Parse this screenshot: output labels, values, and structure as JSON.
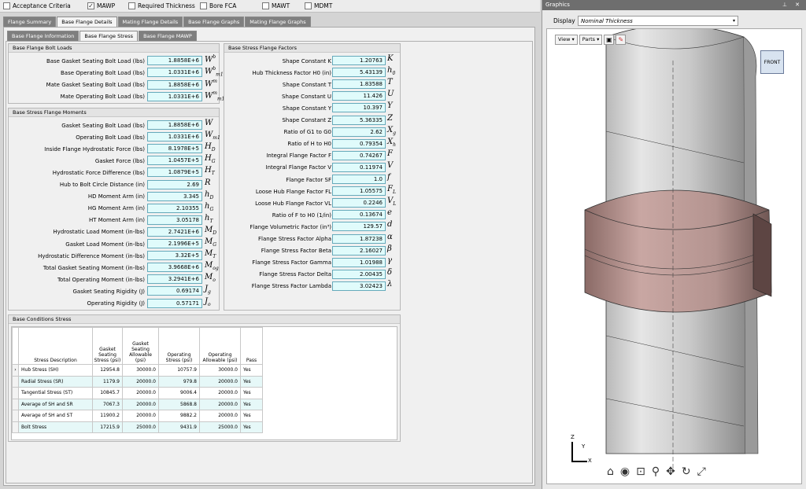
{
  "topbar": [
    {
      "label": "Acceptance Criteria",
      "checked": false
    },
    {
      "label": "MAWP",
      "checked": true
    },
    {
      "label": "Required Thickness",
      "checked": false
    },
    {
      "label": "Bore FCA",
      "checked": false
    },
    {
      "label": "MAWT",
      "checked": false
    },
    {
      "label": "MDMT",
      "checked": false
    }
  ],
  "tabs": [
    "Flange Summary",
    "Base Flange Details",
    "Mating Flange Details",
    "Base Flange Graphs",
    "Mating Flange Graphs"
  ],
  "subtabs": [
    "Base Flange Information",
    "Base Flange Stress",
    "Base Flange MAWP"
  ],
  "bolt_loads": {
    "title": "Base Flange Bolt Loads",
    "rows": [
      {
        "label": "Base Gasket Seating Bolt Load (lbs)",
        "value": "1.8858E+6",
        "sym": "W",
        "sup": "b",
        "sub": ""
      },
      {
        "label": "Base Operating Bolt Load (lbs)",
        "value": "1.0331E+6",
        "sym": "W",
        "sup": "b",
        "sub": "m1"
      },
      {
        "label": "Mate Gasket Seating Bolt Load (lbs)",
        "value": "1.8858E+6",
        "sym": "W",
        "sup": "m",
        "sub": ""
      },
      {
        "label": "Mate Operating Bolt Load (lbs)",
        "value": "1.0331E+6",
        "sym": "W",
        "sup": "m",
        "sub": "m1"
      }
    ]
  },
  "moments": {
    "title": "Base Stress Flange Moments",
    "rows": [
      {
        "label": "Gasket Seating Bolt Load (lbs)",
        "value": "1.8858E+6",
        "sym": "W",
        "sub": ""
      },
      {
        "label": "Operating Bolt Load (lbs)",
        "value": "1.0331E+6",
        "sym": "W",
        "sub": "m1"
      },
      {
        "label": "Inside Flange Hydrostatic Force (lbs)",
        "value": "8.1978E+5",
        "sym": "H",
        "sub": "D"
      },
      {
        "label": "Gasket Force (lbs)",
        "value": "1.0457E+5",
        "sym": "H",
        "sub": "G"
      },
      {
        "label": "Hydrostatic Force Difference (lbs)",
        "value": "1.0879E+5",
        "sym": "H",
        "sub": "T"
      },
      {
        "label": "Hub to Bolt Circle Distance (in)",
        "value": "2.69",
        "sym": "R",
        "sub": ""
      },
      {
        "label": "HD Moment Arm (in)",
        "value": "3.345",
        "sym": "h",
        "sub": "D"
      },
      {
        "label": "HG Moment Arm (in)",
        "value": "2.10355",
        "sym": "h",
        "sub": "G"
      },
      {
        "label": "HT Moment Arm (in)",
        "value": "3.05178",
        "sym": "h",
        "sub": "T"
      },
      {
        "label": "Hydrostatic Load Moment (in-lbs)",
        "value": "2.7421E+6",
        "sym": "M",
        "sub": "D"
      },
      {
        "label": "Gasket Load Moment (in-lbs)",
        "value": "2.1996E+5",
        "sym": "M",
        "sub": "G"
      },
      {
        "label": "Hydrostatic Difference Moment (in-lbs)",
        "value": "3.32E+5",
        "sym": "M",
        "sub": "T"
      },
      {
        "label": "Total Gasket Seating Moment (in-lbs)",
        "value": "3.9668E+6",
        "sym": "M",
        "sub": "og"
      },
      {
        "label": "Total Operating Moment (in-lbs)",
        "value": "3.2941E+6",
        "sym": "M",
        "sub": "o"
      },
      {
        "label": "Gasket Seating Rigidity (J)",
        "value": "0.69174",
        "sym": "J",
        "sub": "g"
      },
      {
        "label": "Operating Rigidity (J)",
        "value": "0.57171",
        "sym": "J",
        "sub": "o"
      }
    ]
  },
  "factors": {
    "title": "Base Stress Flange Factors",
    "rows": [
      {
        "label": "Shape Constant K",
        "value": "1.20763",
        "sym": "K",
        "sub": ""
      },
      {
        "label": "Hub Thickness Factor H0 (in)",
        "value": "5.43139",
        "sym": "h",
        "sub": "0"
      },
      {
        "label": "Shape Constant T",
        "value": "1.83588",
        "sym": "T",
        "sub": ""
      },
      {
        "label": "Shape Constant U",
        "value": "11.426",
        "sym": "U",
        "sub": ""
      },
      {
        "label": "Shape Constant Y",
        "value": "10.397",
        "sym": "Y",
        "sub": ""
      },
      {
        "label": "Shape Constant Z",
        "value": "5.36335",
        "sym": "Z",
        "sub": ""
      },
      {
        "label": "Ratio of G1 to G0",
        "value": "2.62",
        "sym": "X",
        "sub": "g"
      },
      {
        "label": "Ratio of H to H0",
        "value": "0.79354",
        "sym": "X",
        "sub": "h"
      },
      {
        "label": "Integral Flange Factor F",
        "value": "0.74267",
        "sym": "F",
        "sub": ""
      },
      {
        "label": "Integral Flange Factor V",
        "value": "0.11974",
        "sym": "V",
        "sub": ""
      },
      {
        "label": "Flange Factor SF",
        "value": "1.0",
        "sym": "f",
        "sub": ""
      },
      {
        "label": "Loose Hub Flange Factor FL",
        "value": "1.05575",
        "sym": "F",
        "sub": "L"
      },
      {
        "label": "Loose Hub Flange Factor VL",
        "value": "0.2246",
        "sym": "V",
        "sub": "L"
      },
      {
        "label": "Ratio of F to H0 (1/in)",
        "value": "0.13674",
        "sym": "e",
        "sub": ""
      },
      {
        "label": "Flange Volumetric Factor (in³)",
        "value": "129.57",
        "sym": "d",
        "sub": ""
      },
      {
        "label": "Flange Stress Factor Alpha",
        "value": "1.87238",
        "sym": "α",
        "sub": ""
      },
      {
        "label": "Flange Stress Factor Beta",
        "value": "2.16027",
        "sym": "β",
        "sub": ""
      },
      {
        "label": "Flange Stress Factor Gamma",
        "value": "1.01988",
        "sym": "γ",
        "sub": ""
      },
      {
        "label": "Flange Stress Factor Delta",
        "value": "2.00435",
        "sym": "δ",
        "sub": ""
      },
      {
        "label": "Flange Stress Factor Lambda",
        "value": "3.02423",
        "sym": "λ",
        "sub": ""
      }
    ]
  },
  "conditions": {
    "title": "Base Conditions Stress",
    "headers": [
      "Stress Description",
      "Gasket Seating Stress (psi)",
      "Gasket Seating Allowable (psi)",
      "Operating Stress (psi)",
      "Operating Allowable (psi)",
      "Pass"
    ],
    "rows": [
      [
        "Hub Stress (SH)",
        "12954.8",
        "30000.0",
        "10757.9",
        "30000.0",
        "Yes"
      ],
      [
        "Radial Stress (SR)",
        "1179.9",
        "20000.0",
        "979.8",
        "20000.0",
        "Yes"
      ],
      [
        "Tangential Stress (ST)",
        "10845.7",
        "20000.0",
        "9006.4",
        "20000.0",
        "Yes"
      ],
      [
        "Average of SH and SR",
        "7067.3",
        "20000.0",
        "5868.8",
        "20000.0",
        "Yes"
      ],
      [
        "Average of SH and ST",
        "11900.2",
        "20000.0",
        "9882.2",
        "20000.0",
        "Yes"
      ],
      [
        "Bolt Stress",
        "17215.9",
        "25000.0",
        "9431.9",
        "25000.0",
        "Yes"
      ]
    ]
  },
  "graphics": {
    "title": "Graphics",
    "display_label": "Display",
    "display_value": "Nominal Thickness",
    "view_label": "View",
    "parts_label": "Parts",
    "cube_label": "FRONT",
    "axes": {
      "z": "Z",
      "y": "Y",
      "x": "X"
    }
  }
}
